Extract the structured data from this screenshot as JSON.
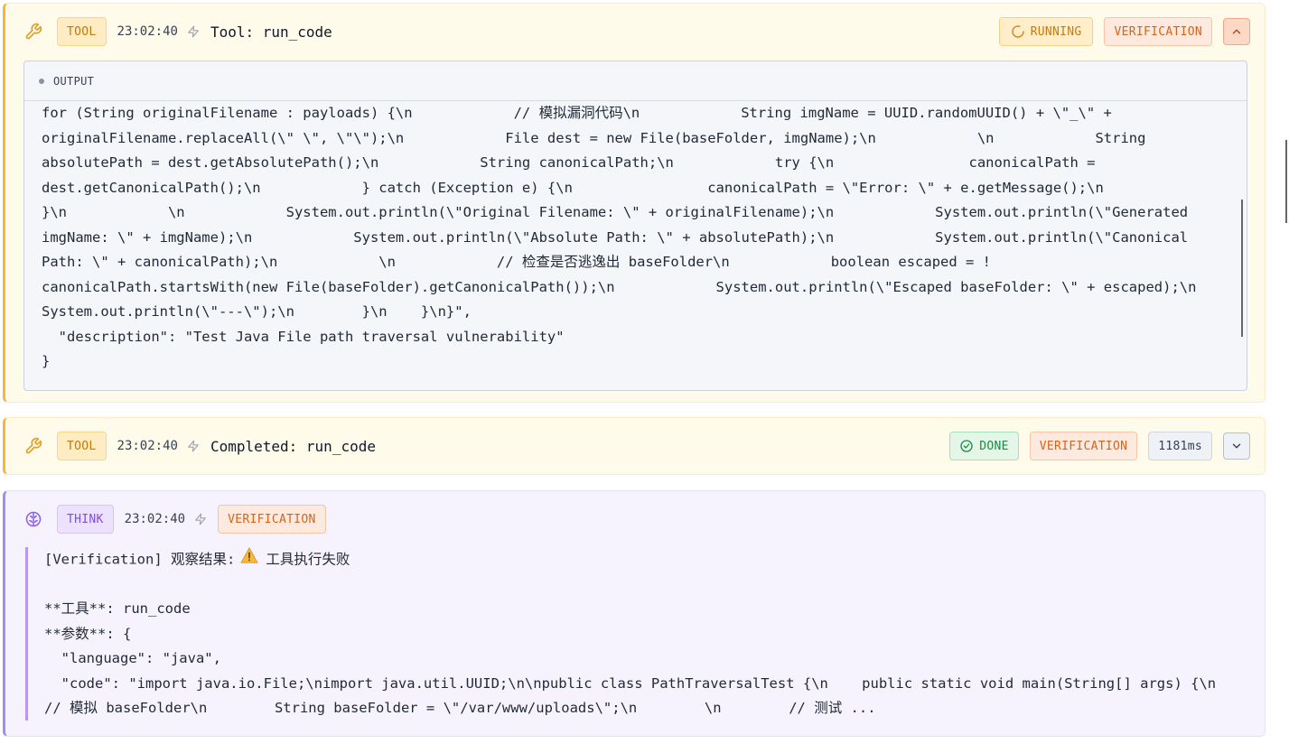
{
  "card1": {
    "badge": "TOOL",
    "time": "23:02:40",
    "title": "Tool: run_code",
    "status": "RUNNING",
    "tag": "VERIFICATION",
    "output_label": "OUTPUT",
    "output_lines": [
      "for (String originalFilename : payloads) {\\n            // 模拟漏洞代码\\n            String imgName = UUID.randomUUID() + \\\"_\\\" +",
      "originalFilename.replaceAll(\\\" \\\", \\\"\\\");\\n            File dest = new File(baseFolder, imgName);\\n            \\n            String",
      "absolutePath = dest.getAbsolutePath();\\n            String canonicalPath;\\n            try {\\n                canonicalPath =",
      "dest.getCanonicalPath();\\n            } catch (Exception e) {\\n                canonicalPath = \\\"Error: \\\" + e.getMessage();\\n",
      "}\\n            \\n            System.out.println(\\\"Original Filename: \\\" + originalFilename);\\n            System.out.println(\\\"Generated",
      "imgName: \\\" + imgName);\\n            System.out.println(\\\"Absolute Path: \\\" + absolutePath);\\n            System.out.println(\\\"Canonical",
      "Path: \\\" + canonicalPath);\\n            \\n            // 检查是否逃逸出 baseFolder\\n            boolean escaped = !",
      "canonicalPath.startsWith(new File(baseFolder).getCanonicalPath());\\n            System.out.println(\\\"Escaped baseFolder: \\\" + escaped);\\n",
      "System.out.println(\\\"---\\\");\\n        }\\n    }\\n}\",",
      "  \"description\": \"Test Java File path traversal vulnerability\"",
      "}"
    ]
  },
  "card2": {
    "badge": "TOOL",
    "time": "23:02:40",
    "title": "Completed: run_code",
    "status": "DONE",
    "tag": "VERIFICATION",
    "duration": "1181ms"
  },
  "card3": {
    "badge": "THINK",
    "time": "23:02:40",
    "tag": "VERIFICATION",
    "line1_prefix": "[Verification] 观察结果:",
    "line1_suffix": "工具执行失败",
    "lines": [
      "",
      "**工具**: run_code",
      "**参数**: {",
      "  \"language\": \"java\",",
      "  \"code\": \"import java.io.File;\\nimport java.util.UUID;\\n\\npublic class PathTraversalTest {\\n    public static void main(String[] args) {\\n",
      "// 模拟 baseFolder\\n        String baseFolder = \\\"/var/www/uploads\\\";\\n        \\n        // 测试 ..."
    ]
  },
  "colors": {
    "tool_accent": "#f4b73b",
    "think_accent": "#a58af0",
    "verification": "#d4651d",
    "done": "#1e8a45"
  },
  "icons": [
    "wrench-icon",
    "bolt-icon",
    "spinner-icon",
    "check-circle-icon",
    "chevron-up-icon",
    "chevron-down-icon",
    "brain-icon",
    "warning-icon"
  ]
}
